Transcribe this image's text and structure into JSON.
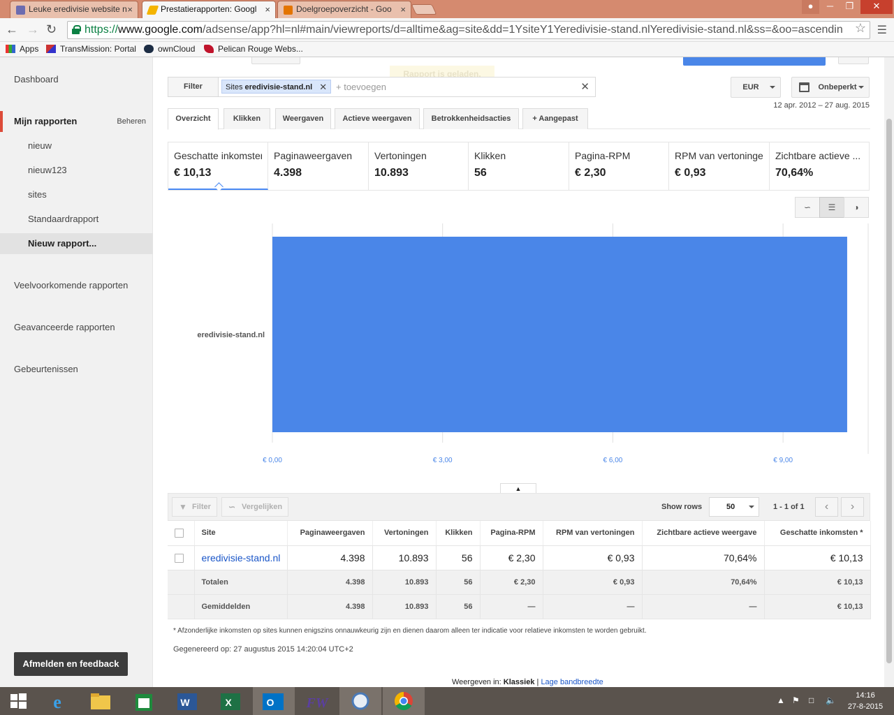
{
  "browser": {
    "tabs": [
      {
        "title": "Leuke eredivisie website n",
        "favicon_color": "#6c6cb0"
      },
      {
        "title": "Prestatierapporten: Googl",
        "favicon_color": "#f4b400"
      },
      {
        "title": "Doelgroepoverzicht - Goo",
        "favicon_color": "#e37400"
      }
    ],
    "url_scheme": "https://",
    "url_host": "www.google.com",
    "url_path": "/adsense/app?hl=nl#main/viewreports/d=alltime&ag=site&dd=1YsiteY1Yeredivisie-stand.nlYeredivisie-stand.nl&ss=&oo=ascendin",
    "bookmarks": [
      "Apps",
      "TransMission: Portal",
      "ownCloud",
      "Pelican Rouge Webs..."
    ]
  },
  "sidebar": {
    "dashboard": "Dashboard",
    "my_reports": "Mijn rapporten",
    "manage": "Beheren",
    "sub_items": [
      "nieuw",
      "nieuw123",
      "sites",
      "Standaardrapport",
      "Nieuw rapport..."
    ],
    "common_reports": "Veelvoorkomende rapporten",
    "advanced_reports": "Geavanceerde rapporten",
    "events": "Gebeurtenissen",
    "signout": "Afmelden en feedback"
  },
  "toast": "Rapport is geladen.",
  "filter": {
    "label": "Filter",
    "chip_prefix": "Sites",
    "chip_value": "eredivisie-stand.nl",
    "add_placeholder": "+ toevoegen"
  },
  "currency": "EUR",
  "date_preset": "Onbeperkt",
  "date_range": "12 apr. 2012 – 27 aug. 2015",
  "report_tabs": [
    "Overzicht",
    "Klikken",
    "Weergaven",
    "Actieve weergaven",
    "Betrokkenheidsacties",
    "+ Aangepast"
  ],
  "metrics": [
    {
      "label": "Geschatte inkomsten",
      "value": "€ 10,13"
    },
    {
      "label": "Paginaweergaven",
      "value": "4.398"
    },
    {
      "label": "Vertoningen",
      "value": "10.893"
    },
    {
      "label": "Klikken",
      "value": "56"
    },
    {
      "label": "Pagina-RPM",
      "value": "€ 2,30"
    },
    {
      "label": "RPM van vertoningen",
      "value": "€ 0,93"
    },
    {
      "label": "Zichtbare actieve ...",
      "value": "70,64%"
    }
  ],
  "chart_data": {
    "type": "bar",
    "orientation": "horizontal",
    "categories": [
      "eredivisie-stand.nl"
    ],
    "values": [
      10.13
    ],
    "xlim": [
      0,
      10.5
    ],
    "xticks": [
      0,
      3,
      6,
      9
    ],
    "xtick_labels": [
      "€ 0,00",
      "€ 3,00",
      "€ 6,00",
      "€ 9,00"
    ],
    "bar_color": "#4a86e8",
    "grid": true
  },
  "table_toolbar": {
    "filter": "Filter",
    "compare": "Vergelijken",
    "show_rows_label": "Show rows",
    "rows_value": "50",
    "page_info": "1 - 1 of 1"
  },
  "table": {
    "headers": [
      "Site",
      "Paginaweergaven",
      "Vertoningen",
      "Klikken",
      "Pagina-RPM",
      "RPM van vertoningen",
      "Zichtbare actieve weergave",
      "Geschatte inkomsten *"
    ],
    "rows": [
      [
        "eredivisie-stand.nl",
        "4.398",
        "10.893",
        "56",
        "€ 2,30",
        "€ 0,93",
        "70,64%",
        "€ 10,13"
      ]
    ],
    "totals": [
      "Totalen",
      "4.398",
      "10.893",
      "56",
      "€ 2,30",
      "€ 0,93",
      "70,64%",
      "€ 10,13"
    ],
    "averages": [
      "Gemiddelden",
      "4.398",
      "10.893",
      "56",
      "—",
      "—",
      "—",
      "€ 10,13"
    ]
  },
  "footnote": "* Afzonderlijke inkomsten op sites kunnen enigszins onnauwkeurig zijn en dienen daarom alleen ter indicatie voor relatieve inkomsten te worden gebruikt.",
  "generated": "Gegenereerd op: 27 augustus 2015 14:20:04 UTC+2",
  "view_mode": {
    "prefix": "Weergeven in:",
    "classic": "Klassiek",
    "separator": "|",
    "low_bandwidth": "Lage bandbreedte"
  },
  "taskbar": {
    "time": "14:16",
    "date": "27-8-2015"
  }
}
